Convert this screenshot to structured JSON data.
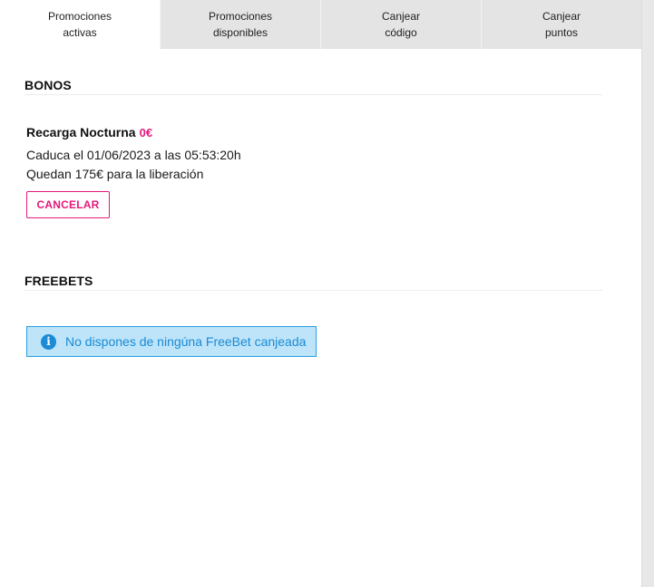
{
  "tabs": [
    {
      "line1": "Promociones",
      "line2": "activas",
      "active": true
    },
    {
      "line1": "Promociones",
      "line2": "disponibles",
      "active": false
    },
    {
      "line1": "Canjear",
      "line2": "código",
      "active": false
    },
    {
      "line1": "Canjear",
      "line2": "puntos",
      "active": false
    }
  ],
  "bonos": {
    "title": "BONOS",
    "item": {
      "name": "Recarga Nocturna",
      "amount": "0€",
      "expiry": "Caduca el 01/06/2023 a las 05:53:20h",
      "remaining": "Quedan 175€ para la liberación",
      "cancel_label": "CANCELAR"
    }
  },
  "freebets": {
    "title": "FREEBETS",
    "info_message": "No dispones de ningúna FreeBet canjeada",
    "info_icon": "info-icon"
  },
  "colors": {
    "accent": "#e5197b",
    "info_bg": "#bde4f9",
    "info_border": "#27a0e0",
    "info_text": "#1a8bd4",
    "tab_inactive": "#e4e4e4"
  }
}
